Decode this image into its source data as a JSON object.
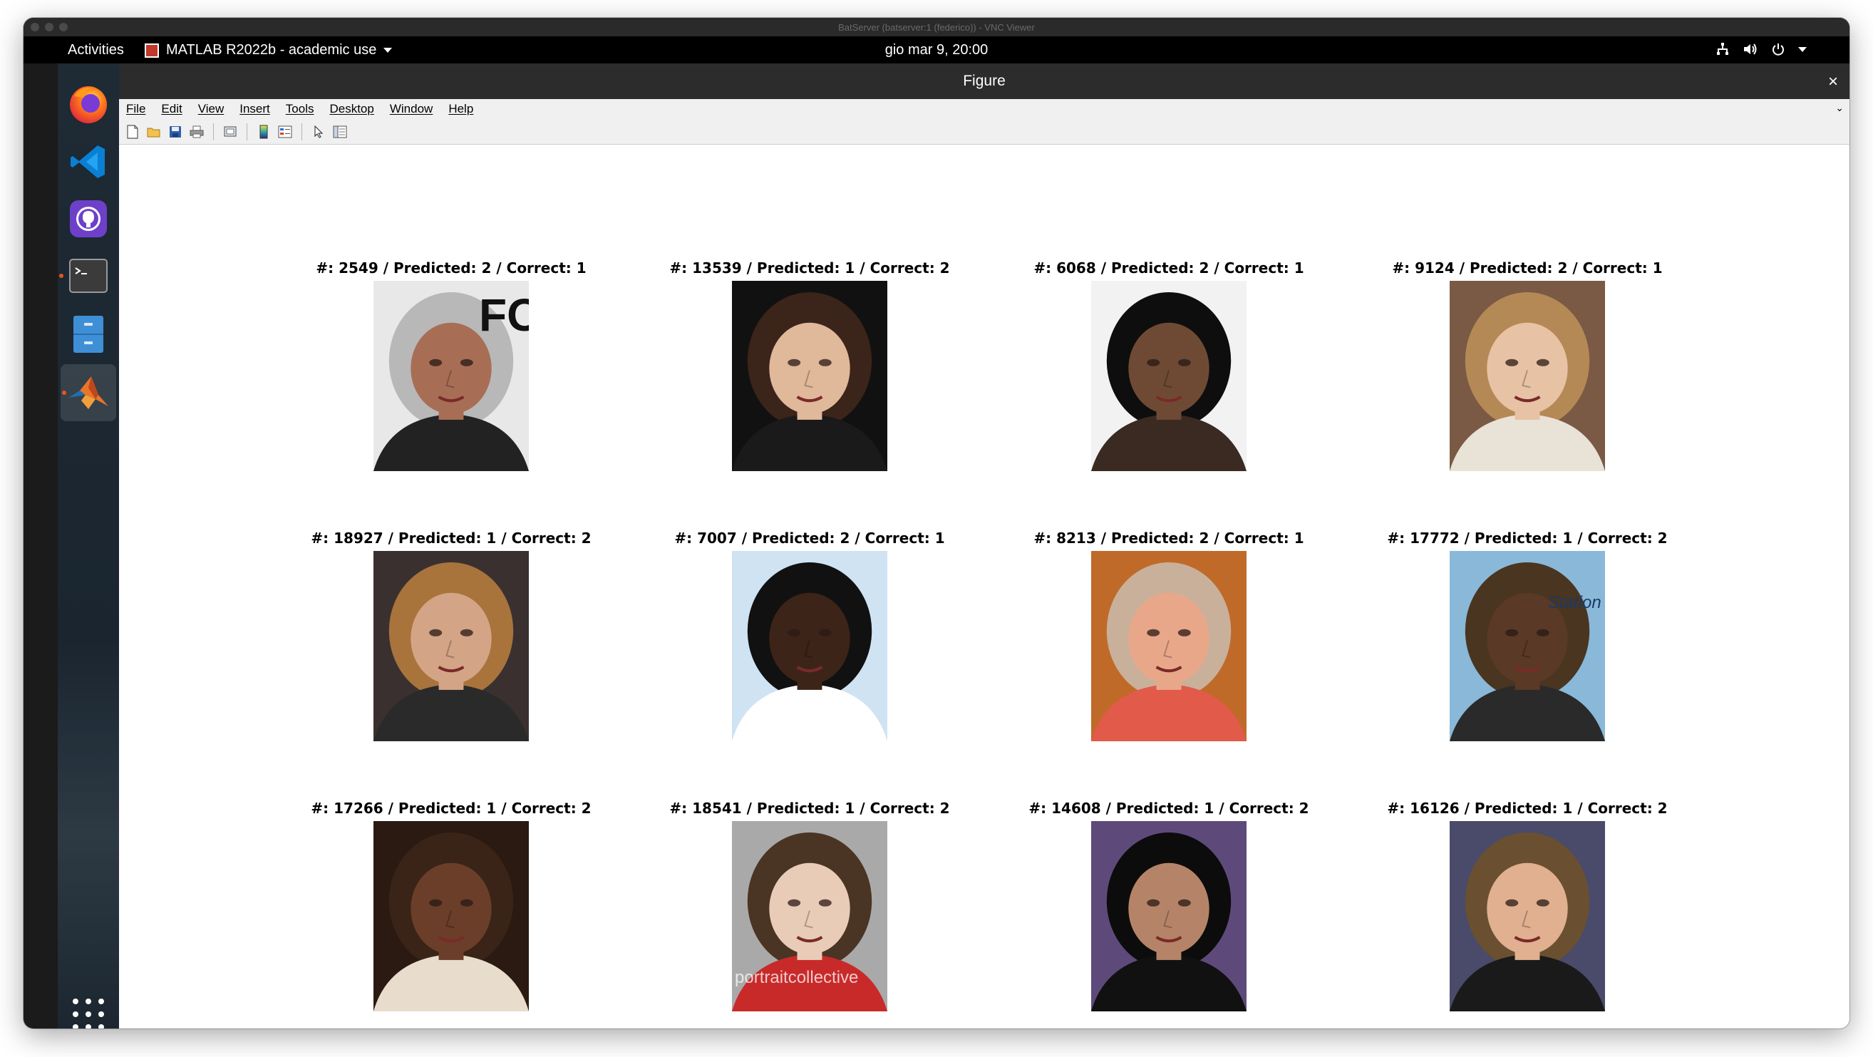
{
  "vnc": {
    "title": "BatServer (batserver:1 (federico)) - VNC Viewer"
  },
  "gnome": {
    "activities": "Activities",
    "app_name": "MATLAB R2022b - academic use",
    "clock": "gio mar  9, 20:00"
  },
  "dock": {
    "items": [
      "firefox-icon",
      "vscode-icon",
      "github-desktop-icon",
      "terminal-icon",
      "files-icon",
      "matlab-icon"
    ],
    "show_apps": "apps-grid-icon"
  },
  "figure": {
    "title": "Figure",
    "close": "×",
    "menu": [
      "File",
      "Edit",
      "View",
      "Insert",
      "Tools",
      "Desktop",
      "Window",
      "Help"
    ],
    "restore": "⌄"
  },
  "faces": [
    {
      "title": "#: 2549 / Predicted: 2 / Correct: 1",
      "bg": "#e8e8e8",
      "skin": "#a86e55",
      "hair": "#b8b8b8",
      "shirt": "#222222",
      "overlay": "FOI"
    },
    {
      "title": "#: 13539 / Predicted: 1 / Correct: 2",
      "bg": "#111111",
      "skin": "#e0b89a",
      "hair": "#3b2419",
      "shirt": "#1a1a1a",
      "overlay": ""
    },
    {
      "title": "#: 6068 / Predicted: 2 / Correct: 1",
      "bg": "#f2f2f2",
      "skin": "#6e4a35",
      "hair": "#0e0e0e",
      "shirt": "#3b2a22",
      "overlay": ""
    },
    {
      "title": "#: 9124 / Predicted: 2 / Correct: 1",
      "bg": "#7a5a45",
      "skin": "#e7c2a4",
      "hair": "#b58955",
      "shirt": "#e9e2d6",
      "overlay": ""
    },
    {
      "title": "#: 18927 / Predicted: 1 / Correct: 2",
      "bg": "#3a3030",
      "skin": "#d4a487",
      "hair": "#a8743c",
      "shirt": "#2a2a2a",
      "overlay": ""
    },
    {
      "title": "#: 7007 / Predicted: 2 / Correct: 1",
      "bg": "#cfe3f3",
      "skin": "#3d2418",
      "hair": "#111111",
      "shirt": "#ffffff",
      "overlay": ""
    },
    {
      "title": "#: 8213 / Predicted: 2 / Correct: 1",
      "bg": "#c06a2a",
      "skin": "#e9a78a",
      "hair": "#c9b09a",
      "shirt": "#e25a4a",
      "overlay": ""
    },
    {
      "title": "#: 17772 / Predicted: 1 / Correct: 2",
      "bg": "#8ab8d8",
      "skin": "#5a3926",
      "hair": "#4a3520",
      "shirt": "#2a2a2a",
      "overlay": "Station"
    },
    {
      "title": "#: 17266 / Predicted: 1 / Correct: 2",
      "bg": "#2a1a12",
      "skin": "#6a3e28",
      "hair": "#3a2418",
      "shirt": "#e8dccc",
      "overlay": ""
    },
    {
      "title": "#: 18541 / Predicted: 1 / Correct: 2",
      "bg": "#a9a9a9",
      "skin": "#e9ccb8",
      "hair": "#4a3424",
      "shirt": "#c82a2a",
      "overlay": "portraitcollective"
    },
    {
      "title": "#: 14608 / Predicted: 1 / Correct: 2",
      "bg": "#5e4a7a",
      "skin": "#b58468",
      "hair": "#0c0c0c",
      "shirt": "#111111",
      "overlay": ""
    },
    {
      "title": "#: 16126 / Predicted: 1 / Correct: 2",
      "bg": "#4a4a6a",
      "skin": "#e0b090",
      "hair": "#6a5030",
      "shirt": "#1a1a1a",
      "overlay": ""
    }
  ]
}
